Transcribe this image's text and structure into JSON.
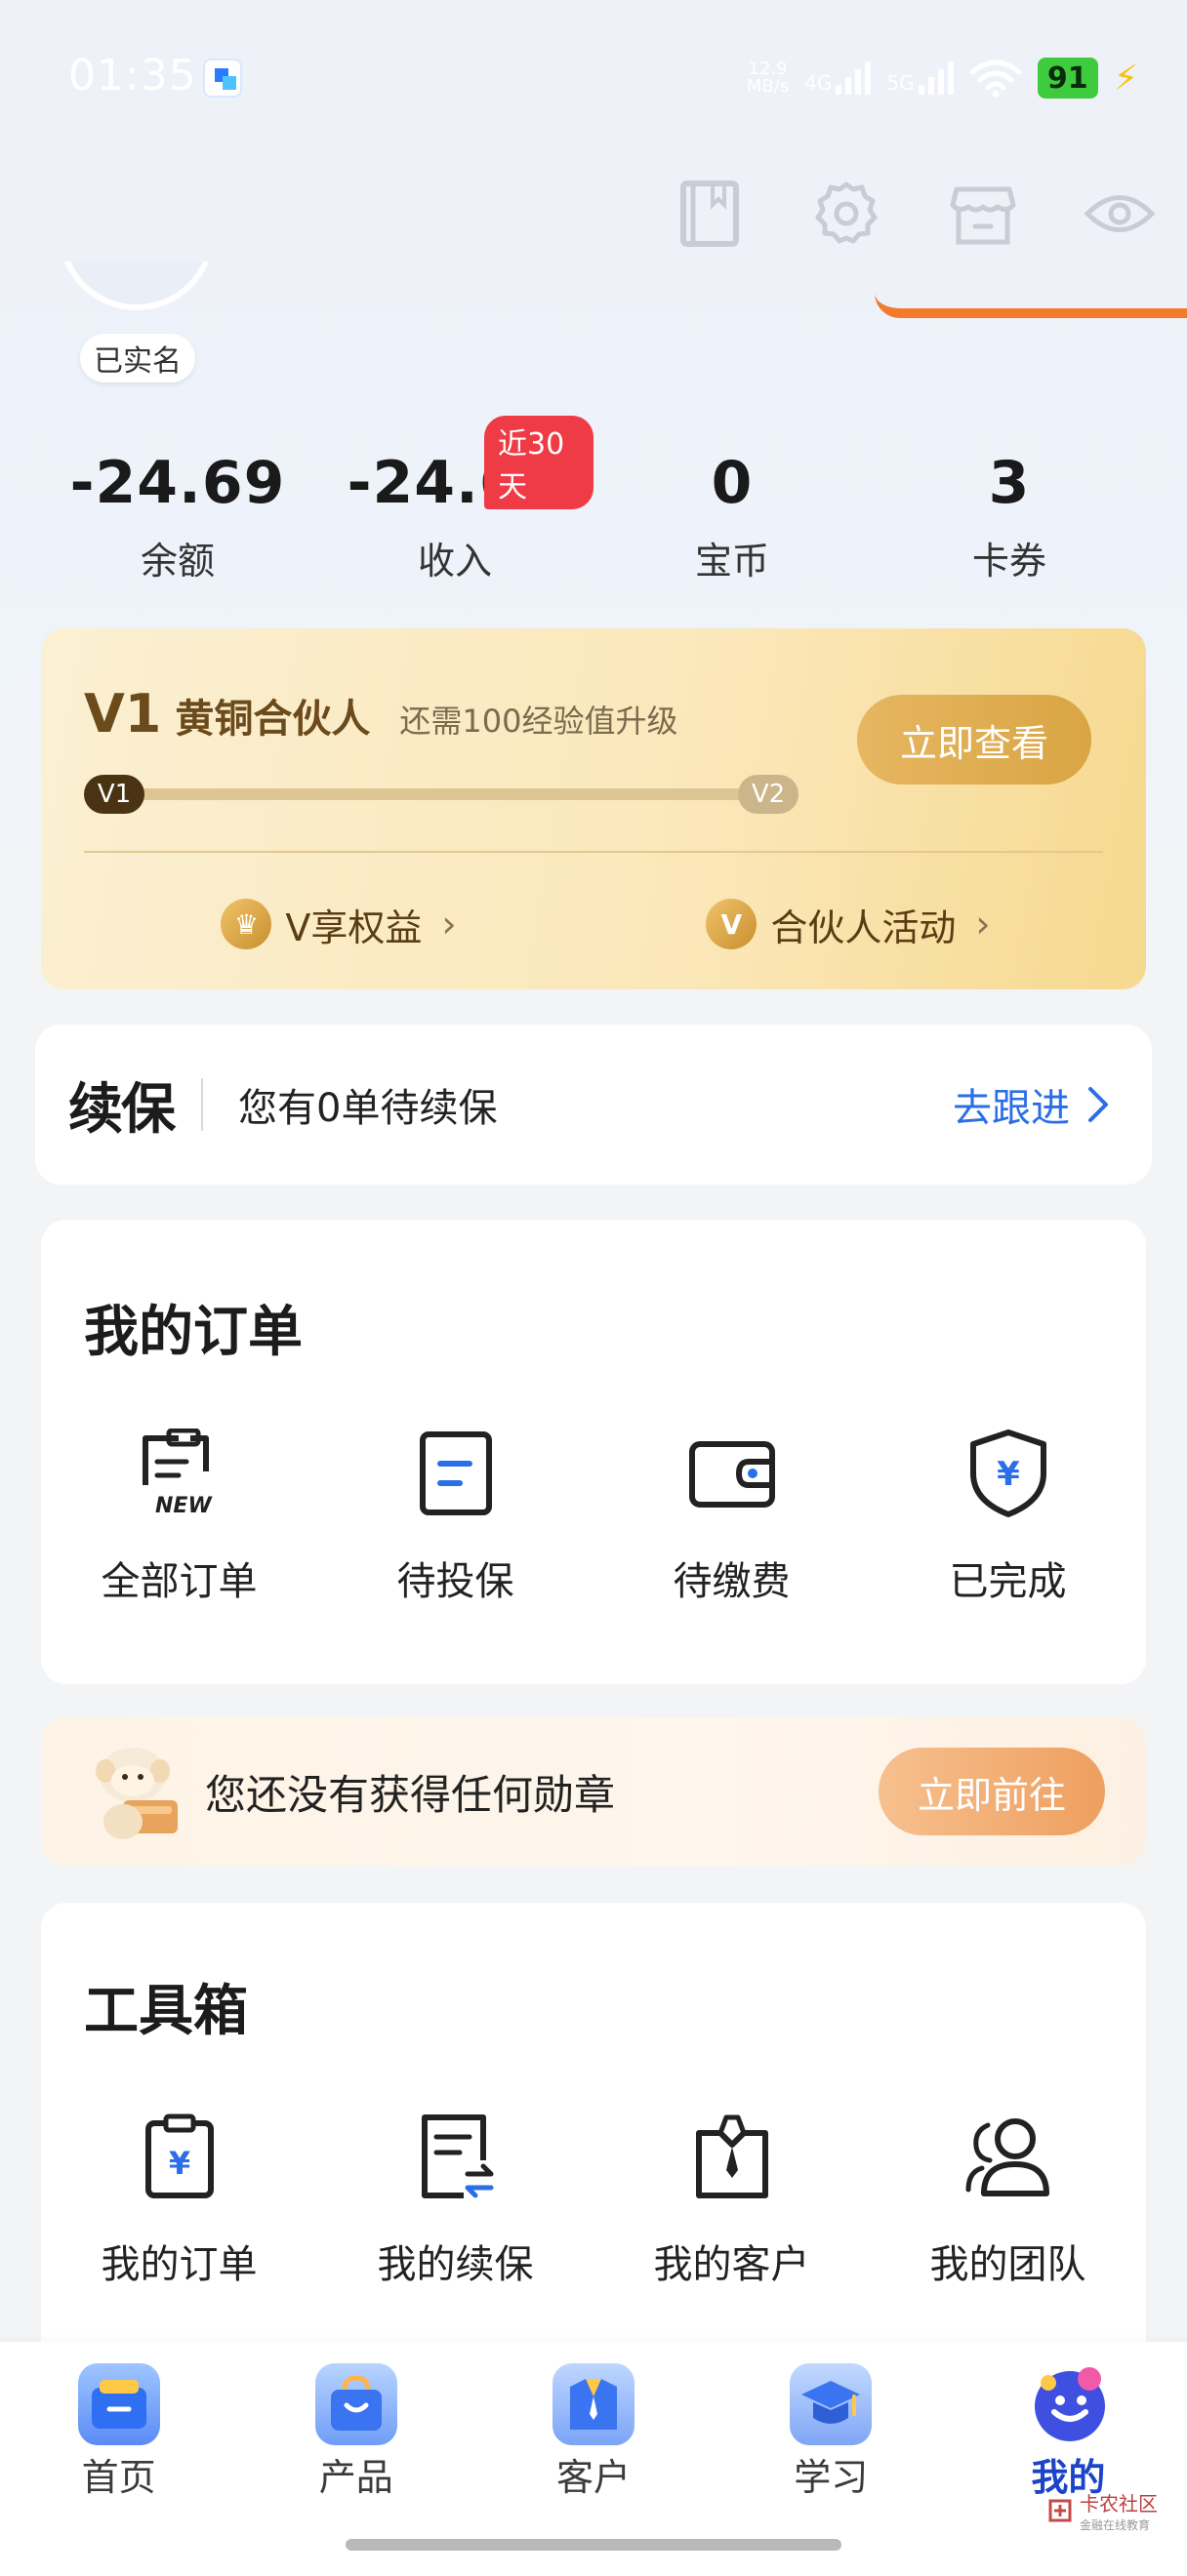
{
  "status_bar": {
    "time": "01:35",
    "net_speed_value": "12.9",
    "net_speed_unit": "MB/s",
    "net1": "4G",
    "net2": "5G",
    "battery": "91"
  },
  "profile": {
    "verified_label": "已实名"
  },
  "stats": [
    {
      "value": "-24.69",
      "label": "余额"
    },
    {
      "value": "-24.69",
      "label": "收入",
      "tag": "近30天"
    },
    {
      "value": "0",
      "label": "宝币"
    },
    {
      "value": "3",
      "label": "卡券"
    }
  ],
  "member": {
    "level_code": "V1",
    "level_name": "黄铜合伙人",
    "hint": "还需100经验值升级",
    "button": "立即查看",
    "progress_from": "V1",
    "progress_to": "V2",
    "progress_fraction": 0.02,
    "link_benefits": "V享权益",
    "link_activity": "合伙人活动"
  },
  "renewal": {
    "logo_prefix": "续",
    "logo_suffix": "保",
    "text": "您有0单待续保",
    "action": "去跟进"
  },
  "orders": {
    "title": "我的订单",
    "items": [
      {
        "label": "全部订单",
        "icon": "all-orders-new-icon"
      },
      {
        "label": "待投保",
        "icon": "pending-insure-icon"
      },
      {
        "label": "待缴费",
        "icon": "wallet-icon"
      },
      {
        "label": "已完成",
        "icon": "yuan-shield-icon"
      }
    ]
  },
  "medal": {
    "text": "您还没有获得任何勋章",
    "button": "立即前往"
  },
  "toolbox": {
    "title": "工具箱",
    "items": [
      {
        "label": "我的订单",
        "icon": "yuan-clipboard-icon"
      },
      {
        "label": "我的续保",
        "icon": "renewal-doc-icon"
      },
      {
        "label": "我的客户",
        "icon": "customer-tie-icon"
      },
      {
        "label": "我的团队",
        "icon": "team-people-icon"
      }
    ]
  },
  "nav": [
    {
      "label": "首页",
      "icon": "home-icon"
    },
    {
      "label": "产品",
      "icon": "shopping-bag-icon"
    },
    {
      "label": "客户",
      "icon": "customer-shirt-icon"
    },
    {
      "label": "学习",
      "icon": "graduation-cap-icon"
    },
    {
      "label": "我的",
      "icon": "mascot-profile-icon",
      "active": true
    }
  ],
  "watermark": {
    "title": "卡农社区",
    "subtitle": "金融在线教育"
  },
  "colors": {
    "accent_blue": "#2a6ee8",
    "tag_red": "#ef3b45",
    "gold": "#d9a544",
    "orange": "#f26b2a",
    "battery_green": "#3ecb3e"
  }
}
